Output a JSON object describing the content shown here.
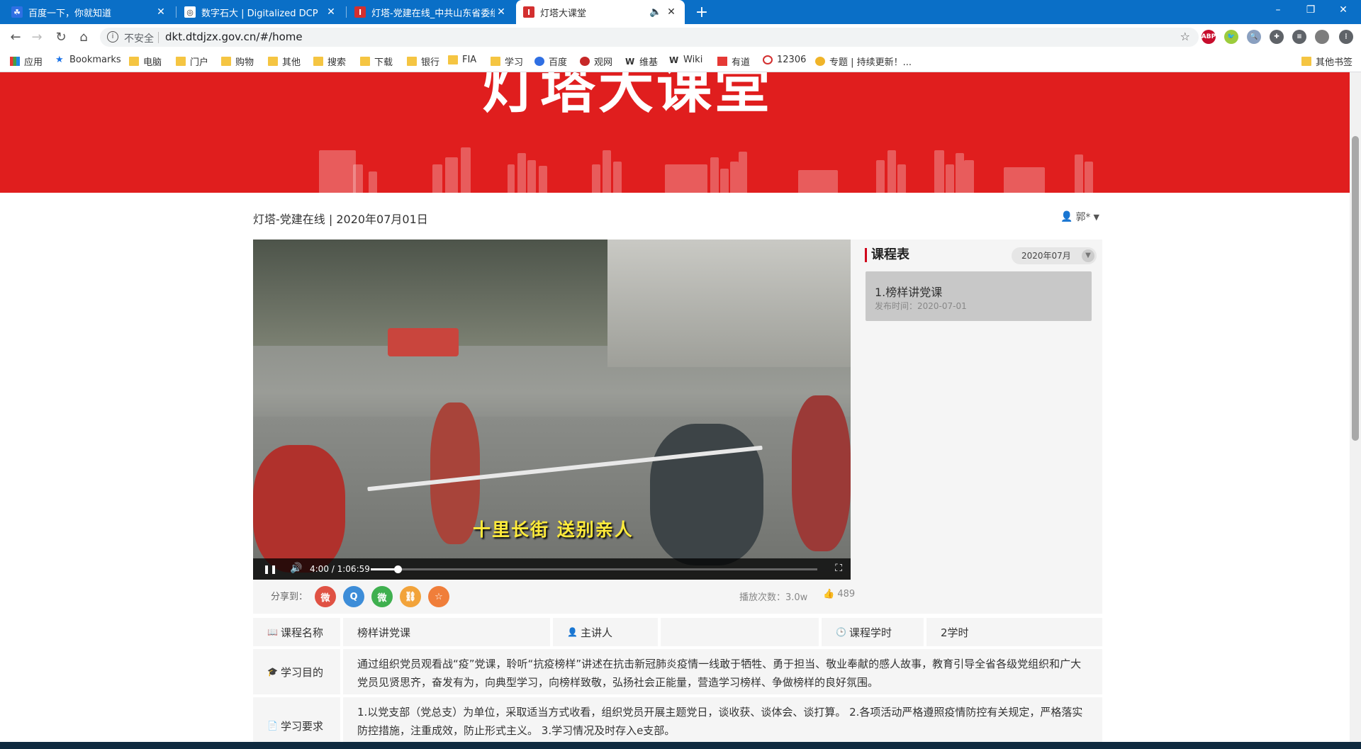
{
  "browser": {
    "tabs": [
      {
        "title": "百度一下，你就知道",
        "favicon_color": "#2f6fe3",
        "favicon_glyph": "☘",
        "active": false
      },
      {
        "title": "数字石大 | Digitalized DCP",
        "favicon_color": "#ffffff",
        "favicon_glyph": "◎",
        "active": false
      },
      {
        "title": "灯塔-党建在线_中共山东省委组织部",
        "favicon_color": "#d32f2f",
        "favicon_glyph": "I",
        "active": false
      },
      {
        "title": "灯塔大课堂",
        "favicon_color": "#d32f2f",
        "favicon_glyph": "I",
        "active": true
      }
    ],
    "new_tab_glyph": "+",
    "window_controls": [
      "–",
      "❐",
      "✕"
    ],
    "nav": {
      "back": "←",
      "forward": "→",
      "reload": "↻",
      "home": "⌂"
    },
    "omnibox": {
      "info_glyph": "i",
      "insecure_label": "不安全",
      "url": "dkt.dtdjzx.gov.cn/#/home",
      "star": "☆"
    },
    "extensions": [
      {
        "name": "abp-icon",
        "label": "ABP",
        "color": "#c70d2c"
      },
      {
        "name": "bird-icon",
        "label": "🐦",
        "color": "#9ccc3c"
      },
      {
        "name": "magnifier-icon",
        "label": "🔍",
        "color": "#8aa0c0"
      },
      {
        "name": "puzzle-icon",
        "label": "✚",
        "color": "#5f6368"
      },
      {
        "name": "media-icon",
        "label": "≡",
        "color": "#5f6368"
      },
      {
        "name": "profile-icon",
        "label": "",
        "color": "#7d7d7d"
      },
      {
        "name": "menu-icon",
        "label": "⋮",
        "color": "#5f6368"
      }
    ],
    "bookmarks": [
      {
        "label": "应用",
        "type": "apps"
      },
      {
        "label": "Bookmarks",
        "type": "star"
      },
      {
        "label": "电脑",
        "type": "folder"
      },
      {
        "label": "门户",
        "type": "folder"
      },
      {
        "label": "购物",
        "type": "folder"
      },
      {
        "label": "其他",
        "type": "folder"
      },
      {
        "label": "搜索",
        "type": "folder"
      },
      {
        "label": "下载",
        "type": "folder"
      },
      {
        "label": "银行",
        "type": "folder"
      },
      {
        "label": "FIA",
        "type": "folder"
      },
      {
        "label": "学习",
        "type": "folder"
      },
      {
        "label": "百度",
        "type": "baidu"
      },
      {
        "label": "观网",
        "type": "guanwang"
      },
      {
        "label": "维基",
        "type": "wiki"
      },
      {
        "label": "Wiki",
        "type": "wiki"
      },
      {
        "label": "有道",
        "type": "youdao"
      },
      {
        "label": "12306",
        "type": "rail"
      },
      {
        "label": "专题 | 持续更新！...",
        "type": "topic"
      }
    ],
    "other_bookmarks": "其他书签"
  },
  "page": {
    "banner_title": "灯塔大课堂",
    "header": "灯塔-党建在线 | 2020年07月01日",
    "user": {
      "name": "郭*",
      "icon": "user-icon"
    },
    "video": {
      "caption": "十里长街  送别亲人",
      "time": "4:00 / 1:06:59",
      "progress": 0.06,
      "play_glyph": "❚❚",
      "volume_glyph": "🔊",
      "fullscreen_glyph": "⛶"
    },
    "schedule": {
      "title": "课程表",
      "month": "2020年07月",
      "items": [
        {
          "title": "1.榜样讲党课",
          "date": "发布时间：2020-07-01"
        }
      ]
    },
    "share": {
      "label": "分享到：",
      "platforms": [
        {
          "name": "weibo-share-icon",
          "glyph": "微",
          "color": "#e05244"
        },
        {
          "name": "qq-share-icon",
          "glyph": "Q",
          "color": "#3d8dd8"
        },
        {
          "name": "wechat-share-icon",
          "glyph": "微",
          "color": "#3fb04f"
        },
        {
          "name": "link-share-icon",
          "glyph": "⛓",
          "color": "#f2a33a"
        },
        {
          "name": "favorite-icon",
          "glyph": "☆",
          "color": "#f07e3a"
        }
      ],
      "play_count": "播放次数：3.0w",
      "likes": "489"
    },
    "info": {
      "course_name_label": "课程名称",
      "course_name": "榜样讲党课",
      "lecturer_label": "主讲人",
      "lecturer": "",
      "hours_label": "课程学时",
      "hours": "2学时",
      "purpose_label": "学习目的",
      "purpose": "通过组织党员观看战“疫”党课，聆听“抗疫榜样”讲述在抗击新冠肺炎疫情一线敢于牺牲、勇于担当、敬业奉献的感人故事，教育引导全省各级党组织和广大党员见贤思齐，奋发有为，向典型学习，向榜样致敬，弘扬社会正能量，营造学习榜样、争做榜样的良好氛围。",
      "requirement_label": "学习要求",
      "requirement": "1.以党支部（党总支）为单位，采取适当方式收看，组织党员开展主题党日，谈收获、谈体会、谈打算。 2.各项活动严格遵照疫情防控有关规定，严格落实防控措施，注重成效，防止形式主义。 3.学习情况及时存入e支部。"
    }
  }
}
